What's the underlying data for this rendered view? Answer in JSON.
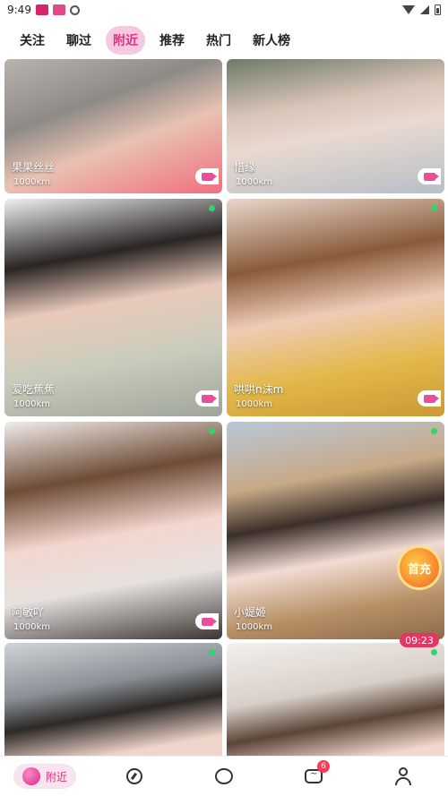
{
  "status_bar": {
    "time": "9:49"
  },
  "tabs": [
    {
      "label": "关注",
      "active": false
    },
    {
      "label": "聊过",
      "active": false
    },
    {
      "label": "附近",
      "active": true
    },
    {
      "label": "推荐",
      "active": false
    },
    {
      "label": "热门",
      "active": false
    },
    {
      "label": "新人榜",
      "active": false
    }
  ],
  "cards": [
    {
      "name": "果果丝丝",
      "distance": "1000km",
      "online": false,
      "video_call": true
    },
    {
      "name": "惜缘",
      "distance": "1000km",
      "online": false,
      "video_call": true
    },
    {
      "name": "爱吃蕉蕉",
      "distance": "1000km",
      "online": true,
      "video_call": true
    },
    {
      "name": "哄哄n沫m",
      "distance": "1000km",
      "online": true,
      "video_call": true
    },
    {
      "name": "阿敏吖",
      "distance": "1000km",
      "online": true,
      "video_call": true
    },
    {
      "name": "小媞姬",
      "distance": "1000km",
      "online": true,
      "video_call": false
    },
    {
      "name": "",
      "distance": "",
      "online": true,
      "video_call": false
    },
    {
      "name": "",
      "distance": "",
      "online": true,
      "video_call": false
    }
  ],
  "promo": {
    "free_label": "首充",
    "timer": "09:23"
  },
  "bottom_nav": {
    "nearby_label": "附近",
    "message_badge": "6",
    "icons": [
      "orb-icon",
      "compass-icon",
      "ring-icon",
      "chat-icon",
      "profile-icon"
    ]
  },
  "colors": {
    "accent": "#e0327f",
    "tab_active_bg": "#f6c9e3",
    "online": "#2ed56b",
    "badge": "#ff3b55"
  }
}
